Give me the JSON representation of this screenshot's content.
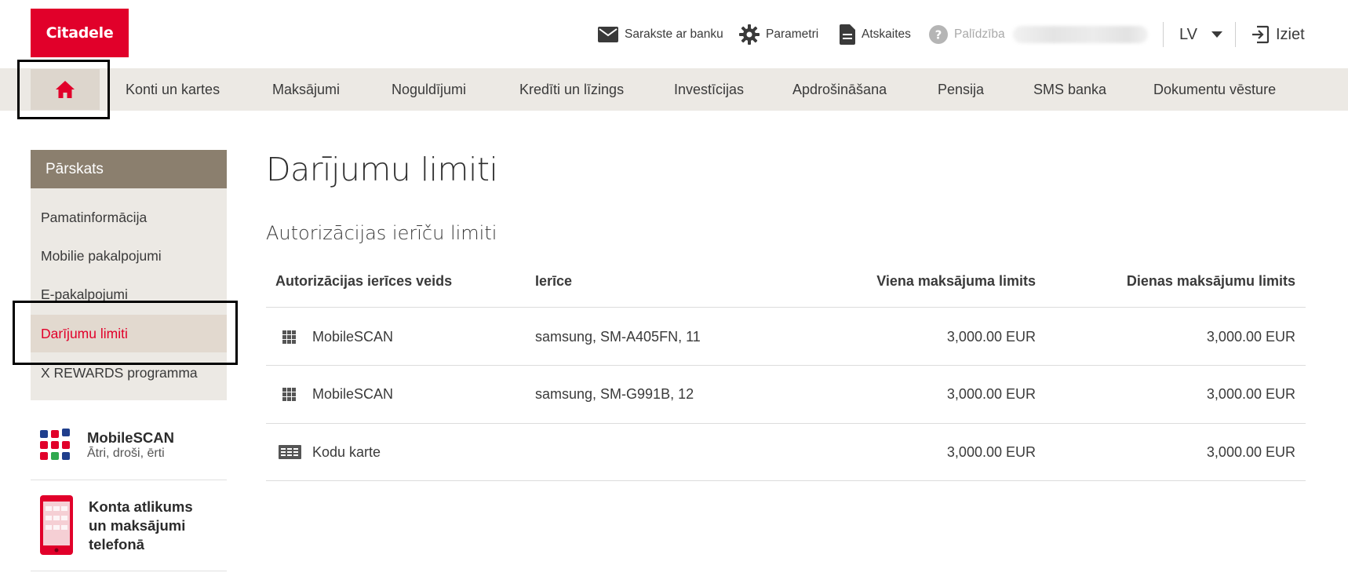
{
  "brand": {
    "logo_text": "Citadele",
    "accent": "#e1002a"
  },
  "header": {
    "correspondence": "Sarakste ar banku",
    "settings": "Parametri",
    "reports": "Atskaites",
    "help": "Palīdzība",
    "language": "LV",
    "logout": "Iziet"
  },
  "nav": {
    "items": [
      "Konti un kartes",
      "Maksājumi",
      "Noguldījumi",
      "Kredīti un līzings",
      "Investīcijas",
      "Apdrošināšana",
      "Pensija",
      "SMS banka",
      "Dokumentu vēsture"
    ]
  },
  "sidebar": {
    "header": "Pārskats",
    "items": [
      "Pamatinformācija",
      "Mobilie pakalpojumi",
      "E-pakalpojumi",
      "Darījumu limiti",
      "X REWARDS programma"
    ],
    "active_index": 3,
    "promos": [
      {
        "title": "MobileSCAN",
        "subtitle": "Ātri, droši, ērti"
      },
      {
        "title": "Konta atlikums un maksājumi telefonā"
      }
    ]
  },
  "main": {
    "title": "Darījumu limiti",
    "section_title": "Autorizācijas ierīču limiti",
    "table": {
      "headers": [
        "Autorizācijas ierīces veids",
        "Ierīce",
        "Viena maksājuma limits",
        "Dienas maksājumu limits"
      ],
      "rows": [
        {
          "type": "MobileSCAN",
          "icon": "grid-icon",
          "device": "samsung, SM-A405FN, 11",
          "single_limit": "3,000.00 EUR",
          "daily_limit": "3,000.00 EUR"
        },
        {
          "type": "MobileSCAN",
          "icon": "grid-icon",
          "device": "samsung, SM-G991B, 12",
          "single_limit": "3,000.00 EUR",
          "daily_limit": "3,000.00 EUR"
        },
        {
          "type": "Kodu karte",
          "icon": "code-card-icon",
          "device": "",
          "single_limit": "3,000.00 EUR",
          "daily_limit": "3,000.00 EUR"
        }
      ]
    }
  }
}
